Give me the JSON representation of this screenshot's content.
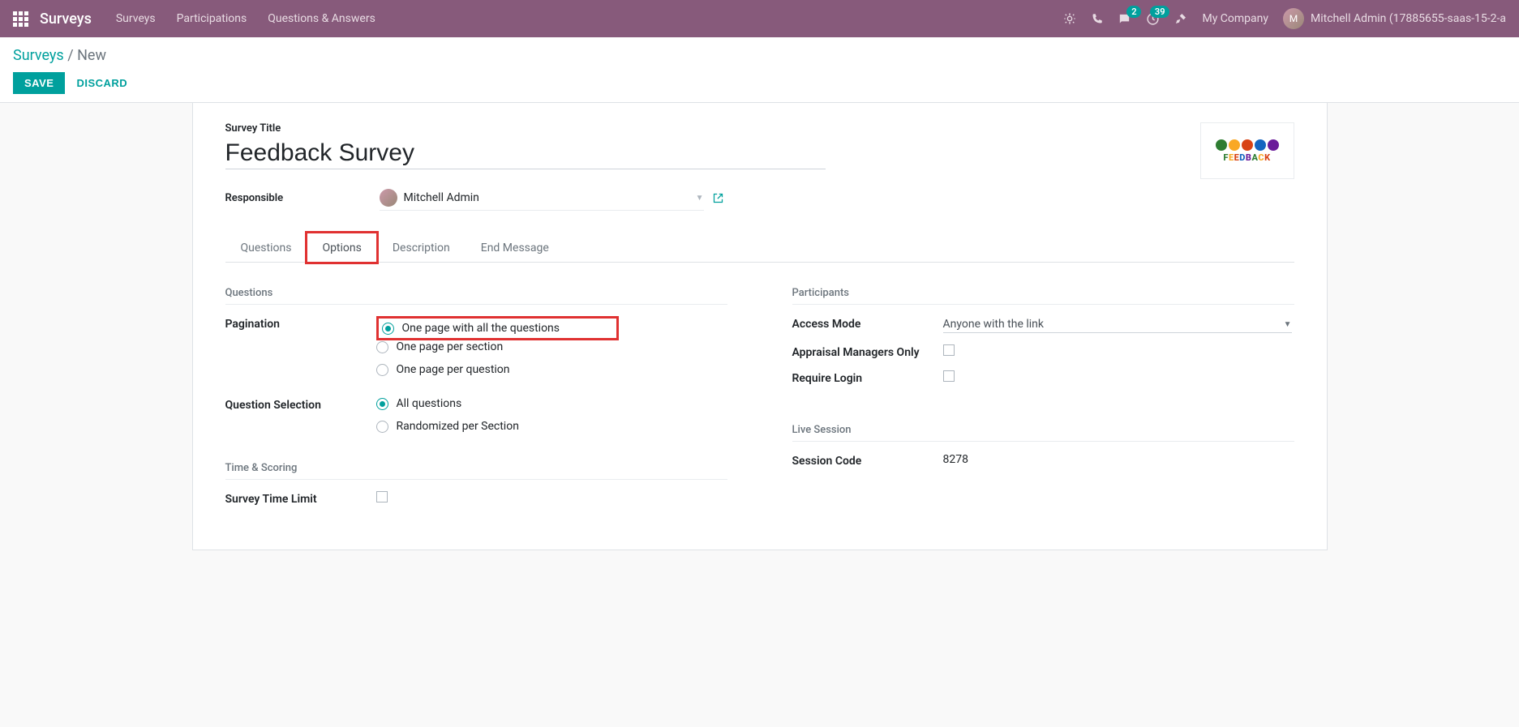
{
  "navbar": {
    "brand": "Surveys",
    "items": [
      "Surveys",
      "Participations",
      "Questions & Answers"
    ],
    "messages_badge": "2",
    "activities_badge": "39",
    "company": "My Company",
    "user": "Mitchell Admin (17885655-saas-15-2-a"
  },
  "breadcrumb": {
    "root": "Surveys",
    "current": "New"
  },
  "actions": {
    "save": "SAVE",
    "discard": "DISCARD"
  },
  "form": {
    "title_label": "Survey Title",
    "title_value": "Feedback Survey",
    "responsible_label": "Responsible",
    "responsible_value": "Mitchell Admin",
    "logo_text": "FEEDBACK"
  },
  "tabs": [
    "Questions",
    "Options",
    "Description",
    "End Message"
  ],
  "options": {
    "left": {
      "section_questions": "Questions",
      "pagination_label": "Pagination",
      "pagination_opts": [
        "One page with all the questions",
        "One page per section",
        "One page per question"
      ],
      "qsel_label": "Question Selection",
      "qsel_opts": [
        "All questions",
        "Randomized per Section"
      ],
      "section_time": "Time & Scoring",
      "time_limit_label": "Survey Time Limit"
    },
    "right": {
      "section_participants": "Participants",
      "access_mode_label": "Access Mode",
      "access_mode_value": "Anyone with the link",
      "appraisal_label": "Appraisal Managers Only",
      "require_login_label": "Require Login",
      "section_live": "Live Session",
      "session_code_label": "Session Code",
      "session_code_value": "8278"
    }
  }
}
